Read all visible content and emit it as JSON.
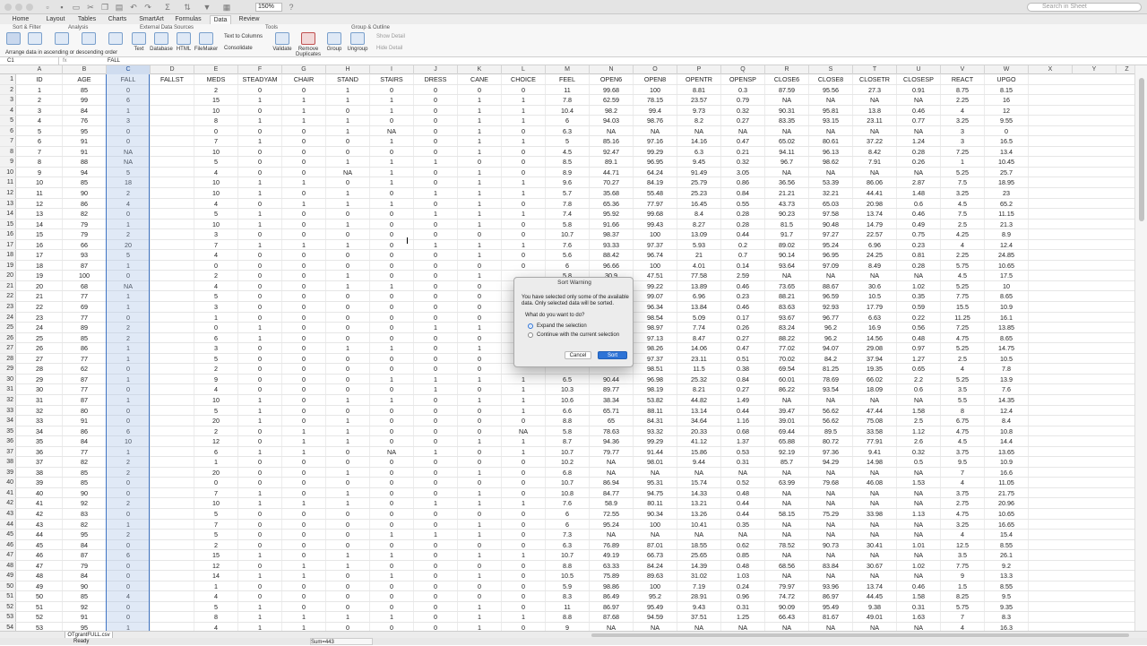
{
  "toolbar": {
    "zoom": "150%",
    "search_placeholder": "Search in Sheet"
  },
  "ribbon_tabs": [
    "Home",
    "Layout",
    "Tables",
    "Charts",
    "SmartArt",
    "Formulas",
    "Data",
    "Review"
  ],
  "active_tab": "Data",
  "ribbon": {
    "groups": [
      "Sort & Filter",
      "Analysis",
      "External Data Sources",
      "Tools",
      "Group & Outline"
    ],
    "buttons": [
      "Text",
      "Database",
      "HTML",
      "FileMaker",
      "Validate",
      "Remove Duplicates",
      "Group",
      "Ungroup"
    ],
    "tools": [
      "Text to Columns",
      "Consolidate"
    ],
    "outline": [
      "Show Detail",
      "Hide Detail"
    ],
    "tooltip": "Arrange data in ascending or descending order"
  },
  "formula_bar": {
    "name_box": "C1",
    "fx": "fx",
    "value": "FALL"
  },
  "columns": [
    "A",
    "B",
    "C",
    "D",
    "E",
    "F",
    "G",
    "H",
    "I",
    "J",
    "K",
    "L",
    "M",
    "N",
    "O",
    "P",
    "Q",
    "R",
    "S",
    "T",
    "U",
    "V",
    "W",
    "X",
    "Y",
    "Z"
  ],
  "selected_column": "C",
  "rows": [
    [
      "ID",
      "AGE",
      "FALL",
      "FALLST",
      "MEDS",
      "STEADYAM",
      "CHAIR",
      "STAND",
      "STAIRS",
      "DRESS",
      "CANE",
      "CHOICE",
      "FEEL",
      "OPEN6",
      "OPEN8",
      "OPENTR",
      "OPENSP",
      "CLOSE6",
      "CLOSE8",
      "CLOSETR",
      "CLOSESP",
      "REACT",
      "UPGO"
    ],
    [
      "1",
      "85",
      "0",
      "",
      "2",
      "0",
      "0",
      "1",
      "0",
      "0",
      "0",
      "0",
      "11",
      "99.68",
      "100",
      "8.81",
      "0.3",
      "87.59",
      "95.56",
      "27.3",
      "0.91",
      "8.75",
      "8.15"
    ],
    [
      "2",
      "99",
      "6",
      "",
      "15",
      "1",
      "1",
      "1",
      "1",
      "0",
      "1",
      "1",
      "7.8",
      "62.59",
      "78.15",
      "23.57",
      "0.79",
      "NA",
      "NA",
      "NA",
      "NA",
      "2.25",
      "16"
    ],
    [
      "3",
      "84",
      "1",
      "",
      "10",
      "0",
      "1",
      "0",
      "1",
      "0",
      "1",
      "1",
      "10.4",
      "98.2",
      "99.4",
      "9.73",
      "0.32",
      "90.31",
      "95.81",
      "13.8",
      "0.46",
      "4",
      "12"
    ],
    [
      "4",
      "76",
      "3",
      "",
      "8",
      "1",
      "1",
      "1",
      "0",
      "0",
      "1",
      "1",
      "6",
      "94.03",
      "98.76",
      "8.2",
      "0.27",
      "83.35",
      "93.15",
      "23.11",
      "0.77",
      "3.25",
      "9.55"
    ],
    [
      "5",
      "95",
      "0",
      "",
      "0",
      "0",
      "0",
      "1",
      "NA",
      "0",
      "1",
      "0",
      "6.3",
      "NA",
      "NA",
      "NA",
      "NA",
      "NA",
      "NA",
      "NA",
      "NA",
      "3",
      "0"
    ],
    [
      "6",
      "91",
      "0",
      "",
      "7",
      "1",
      "0",
      "0",
      "1",
      "0",
      "1",
      "1",
      "5",
      "85.16",
      "97.16",
      "14.16",
      "0.47",
      "65.02",
      "80.61",
      "37.22",
      "1.24",
      "3",
      "16.5"
    ],
    [
      "7",
      "91",
      "NA",
      "",
      "10",
      "0",
      "0",
      "0",
      "0",
      "0",
      "1",
      "0",
      "4.5",
      "92.47",
      "99.29",
      "6.3",
      "0.21",
      "94.11",
      "96.13",
      "8.42",
      "0.28",
      "7.25",
      "13.4"
    ],
    [
      "8",
      "88",
      "NA",
      "",
      "5",
      "0",
      "0",
      "1",
      "1",
      "1",
      "0",
      "0",
      "8.5",
      "89.1",
      "96.95",
      "9.45",
      "0.32",
      "96.7",
      "98.62",
      "7.91",
      "0.26",
      "1",
      "10.45"
    ],
    [
      "9",
      "94",
      "5",
      "",
      "4",
      "0",
      "0",
      "NA",
      "1",
      "0",
      "1",
      "0",
      "8.9",
      "44.71",
      "64.24",
      "91.49",
      "3.05",
      "NA",
      "NA",
      "NA",
      "NA",
      "5.25",
      "25.7"
    ],
    [
      "10",
      "85",
      "18",
      "",
      "10",
      "1",
      "1",
      "0",
      "1",
      "0",
      "1",
      "1",
      "9.6",
      "70.27",
      "84.19",
      "25.79",
      "0.86",
      "36.56",
      "53.39",
      "86.06",
      "2.87",
      "7.5",
      "18.95"
    ],
    [
      "11",
      "90",
      "2",
      "",
      "10",
      "1",
      "0",
      "1",
      "0",
      "1",
      "1",
      "1",
      "5.7",
      "35.68",
      "55.48",
      "25.23",
      "0.84",
      "21.21",
      "32.21",
      "44.41",
      "1.48",
      "3.25",
      "23"
    ],
    [
      "12",
      "86",
      "4",
      "",
      "4",
      "0",
      "1",
      "1",
      "1",
      "0",
      "1",
      "0",
      "7.8",
      "65.36",
      "77.97",
      "16.45",
      "0.55",
      "43.73",
      "65.03",
      "20.98",
      "0.6",
      "4.5",
      "65.2"
    ],
    [
      "13",
      "82",
      "0",
      "",
      "5",
      "1",
      "0",
      "0",
      "0",
      "1",
      "1",
      "1",
      "7.4",
      "95.92",
      "99.68",
      "8.4",
      "0.28",
      "90.23",
      "97.58",
      "13.74",
      "0.46",
      "7.5",
      "11.15"
    ],
    [
      "14",
      "79",
      "1",
      "",
      "10",
      "1",
      "0",
      "1",
      "0",
      "0",
      "1",
      "0",
      "5.8",
      "91.66",
      "99.43",
      "8.27",
      "0.28",
      "81.5",
      "90.48",
      "14.79",
      "0.49",
      "2.5",
      "21.3"
    ],
    [
      "15",
      "79",
      "2",
      "",
      "3",
      "0",
      "0",
      "0",
      "0",
      "0",
      "0",
      "0",
      "10.7",
      "98.37",
      "100",
      "13.09",
      "0.44",
      "91.7",
      "97.27",
      "22.57",
      "0.75",
      "4.25",
      "8.9"
    ],
    [
      "16",
      "66",
      "20",
      "",
      "7",
      "1",
      "1",
      "1",
      "0",
      "1",
      "1",
      "1",
      "7.6",
      "93.33",
      "97.37",
      "5.93",
      "0.2",
      "89.02",
      "95.24",
      "6.96",
      "0.23",
      "4",
      "12.4"
    ],
    [
      "17",
      "93",
      "5",
      "",
      "4",
      "0",
      "0",
      "0",
      "0",
      "0",
      "1",
      "0",
      "5.6",
      "88.42",
      "96.74",
      "21",
      "0.7",
      "90.14",
      "96.95",
      "24.25",
      "0.81",
      "2.25",
      "24.85"
    ],
    [
      "18",
      "87",
      "1",
      "",
      "0",
      "0",
      "0",
      "0",
      "0",
      "0",
      "0",
      "0",
      "6",
      "96.66",
      "100",
      "4.01",
      "0.14",
      "93.64",
      "97.09",
      "8.49",
      "0.28",
      "5.75",
      "10.65"
    ],
    [
      "19",
      "100",
      "0",
      "",
      "2",
      "0",
      "0",
      "1",
      "0",
      "0",
      "1",
      "",
      "5.8",
      "30.9",
      "47.51",
      "77.58",
      "2.59",
      "NA",
      "NA",
      "NA",
      "NA",
      "4.5",
      "17.5"
    ],
    [
      "20",
      "68",
      "NA",
      "",
      "4",
      "0",
      "0",
      "1",
      "1",
      "0",
      "0",
      "",
      "",
      "",
      "99.22",
      "13.89",
      "0.46",
      "73.65",
      "88.67",
      "30.6",
      "1.02",
      "5.25",
      "10"
    ],
    [
      "21",
      "77",
      "1",
      "",
      "5",
      "0",
      "0",
      "0",
      "0",
      "0",
      "0",
      "",
      "",
      "",
      "99.07",
      "6.96",
      "0.23",
      "88.21",
      "96.59",
      "10.5",
      "0.35",
      "7.75",
      "8.65"
    ],
    [
      "22",
      "69",
      "1",
      "",
      "3",
      "0",
      "0",
      "0",
      "0",
      "0",
      "0",
      "",
      "",
      "",
      "96.34",
      "13.84",
      "0.46",
      "83.63",
      "92.93",
      "17.79",
      "0.59",
      "15.5",
      "10.9"
    ],
    [
      "23",
      "77",
      "0",
      "",
      "1",
      "0",
      "0",
      "0",
      "0",
      "0",
      "0",
      "",
      "",
      "",
      "98.54",
      "5.09",
      "0.17",
      "93.67",
      "96.77",
      "6.63",
      "0.22",
      "11.25",
      "16.1"
    ],
    [
      "24",
      "89",
      "2",
      "",
      "0",
      "1",
      "0",
      "0",
      "0",
      "1",
      "1",
      "",
      "",
      "",
      "98.97",
      "7.74",
      "0.26",
      "83.24",
      "96.2",
      "16.9",
      "0.56",
      "7.25",
      "13.85"
    ],
    [
      "25",
      "85",
      "2",
      "",
      "6",
      "1",
      "0",
      "0",
      "0",
      "0",
      "0",
      "",
      "",
      "",
      "97.13",
      "8.47",
      "0.27",
      "88.22",
      "96.2",
      "14.56",
      "0.48",
      "4.75",
      "8.65"
    ],
    [
      "26",
      "86",
      "1",
      "",
      "3",
      "0",
      "0",
      "1",
      "1",
      "0",
      "1",
      "",
      "",
      "",
      "98.26",
      "14.06",
      "0.47",
      "77.02",
      "94.07",
      "29.08",
      "0.97",
      "5.25",
      "14.75"
    ],
    [
      "27",
      "77",
      "1",
      "",
      "5",
      "0",
      "0",
      "0",
      "0",
      "0",
      "0",
      "",
      "",
      "",
      "97.37",
      "23.11",
      "0.51",
      "70.02",
      "84.2",
      "37.94",
      "1.27",
      "2.5",
      "10.5"
    ],
    [
      "28",
      "62",
      "0",
      "",
      "2",
      "0",
      "0",
      "0",
      "0",
      "0",
      "0",
      "",
      "",
      "",
      "98.51",
      "11.5",
      "0.38",
      "69.54",
      "81.25",
      "19.35",
      "0.65",
      "4",
      "7.8"
    ],
    [
      "29",
      "87",
      "1",
      "",
      "9",
      "0",
      "0",
      "0",
      "1",
      "1",
      "1",
      "1",
      "6.5",
      "90.44",
      "96.98",
      "25.32",
      "0.84",
      "60.01",
      "78.69",
      "66.02",
      "2.2",
      "5.25",
      "13.9"
    ],
    [
      "30",
      "77",
      "0",
      "",
      "4",
      "0",
      "0",
      "0",
      "0",
      "1",
      "0",
      "1",
      "10.3",
      "89.77",
      "98.19",
      "8.21",
      "0.27",
      "86.22",
      "93.54",
      "18.09",
      "0.6",
      "3.5",
      "7.6"
    ],
    [
      "31",
      "87",
      "1",
      "",
      "10",
      "1",
      "0",
      "1",
      "1",
      "0",
      "1",
      "1",
      "10.6",
      "38.34",
      "53.82",
      "44.82",
      "1.49",
      "NA",
      "NA",
      "NA",
      "NA",
      "5.5",
      "14.35"
    ],
    [
      "32",
      "80",
      "0",
      "",
      "5",
      "1",
      "0",
      "0",
      "0",
      "0",
      "0",
      "1",
      "6.6",
      "65.71",
      "88.11",
      "13.14",
      "0.44",
      "39.47",
      "56.62",
      "47.44",
      "1.58",
      "8",
      "12.4"
    ],
    [
      "33",
      "91",
      "0",
      "",
      "20",
      "1",
      "0",
      "1",
      "0",
      "0",
      "0",
      "0",
      "8.8",
      "65",
      "84.31",
      "34.64",
      "1.16",
      "39.01",
      "56.62",
      "75.08",
      "2.5",
      "6.75",
      "8.4"
    ],
    [
      "34",
      "86",
      "6",
      "",
      "2",
      "0",
      "1",
      "1",
      "0",
      "0",
      "0",
      "NA",
      "5.8",
      "78.63",
      "93.32",
      "20.33",
      "0.68",
      "69.44",
      "89.5",
      "33.58",
      "1.12",
      "4.75",
      "10.8"
    ],
    [
      "35",
      "84",
      "10",
      "",
      "12",
      "0",
      "1",
      "1",
      "0",
      "0",
      "1",
      "1",
      "8.7",
      "94.36",
      "99.29",
      "41.12",
      "1.37",
      "65.88",
      "80.72",
      "77.91",
      "2.6",
      "4.5",
      "14.4"
    ],
    [
      "36",
      "77",
      "1",
      "",
      "6",
      "1",
      "1",
      "0",
      "NA",
      "1",
      "0",
      "1",
      "10.7",
      "79.77",
      "91.44",
      "15.86",
      "0.53",
      "92.19",
      "97.36",
      "9.41",
      "0.32",
      "3.75",
      "13.65"
    ],
    [
      "37",
      "82",
      "2",
      "",
      "1",
      "0",
      "0",
      "0",
      "0",
      "0",
      "0",
      "0",
      "10.2",
      "NA",
      "98.01",
      "9.44",
      "0.31",
      "85.7",
      "94.29",
      "14.98",
      "0.5",
      "9.5",
      "10.9"
    ],
    [
      "38",
      "85",
      "2",
      "",
      "20",
      "0",
      "0",
      "1",
      "0",
      "0",
      "1",
      "0",
      "6.8",
      "NA",
      "NA",
      "NA",
      "NA",
      "NA",
      "NA",
      "NA",
      "NA",
      "7",
      "16.6"
    ],
    [
      "39",
      "85",
      "0",
      "",
      "0",
      "0",
      "0",
      "0",
      "0",
      "0",
      "0",
      "0",
      "10.7",
      "86.94",
      "95.31",
      "15.74",
      "0.52",
      "63.99",
      "79.68",
      "46.08",
      "1.53",
      "4",
      "11.05"
    ],
    [
      "40",
      "90",
      "0",
      "",
      "7",
      "1",
      "0",
      "1",
      "0",
      "0",
      "1",
      "0",
      "10.8",
      "84.77",
      "94.75",
      "14.33",
      "0.48",
      "NA",
      "NA",
      "NA",
      "NA",
      "3.75",
      "21.75"
    ],
    [
      "41",
      "92",
      "2",
      "",
      "10",
      "1",
      "1",
      "1",
      "0",
      "1",
      "1",
      "1",
      "7.6",
      "58.9",
      "80.11",
      "13.21",
      "0.44",
      "NA",
      "NA",
      "NA",
      "NA",
      "2.75",
      "20.96"
    ],
    [
      "42",
      "83",
      "0",
      "",
      "5",
      "0",
      "0",
      "0",
      "0",
      "0",
      "0",
      "0",
      "6",
      "72.55",
      "90.34",
      "13.26",
      "0.44",
      "58.15",
      "75.29",
      "33.98",
      "1.13",
      "4.75",
      "10.65"
    ],
    [
      "43",
      "82",
      "1",
      "",
      "7",
      "0",
      "0",
      "0",
      "0",
      "0",
      "1",
      "0",
      "6",
      "95.24",
      "100",
      "10.41",
      "0.35",
      "NA",
      "NA",
      "NA",
      "NA",
      "3.25",
      "16.65"
    ],
    [
      "44",
      "95",
      "2",
      "",
      "5",
      "0",
      "0",
      "0",
      "1",
      "1",
      "1",
      "0",
      "7.3",
      "NA",
      "NA",
      "NA",
      "NA",
      "NA",
      "NA",
      "NA",
      "NA",
      "4",
      "15.4"
    ],
    [
      "45",
      "84",
      "0",
      "",
      "2",
      "0",
      "0",
      "0",
      "0",
      "0",
      "0",
      "0",
      "6.3",
      "76.89",
      "87.01",
      "18.55",
      "0.62",
      "78.52",
      "90.73",
      "30.41",
      "1.01",
      "12.5",
      "8.55"
    ],
    [
      "46",
      "87",
      "6",
      "",
      "15",
      "1",
      "0",
      "1",
      "1",
      "0",
      "1",
      "1",
      "10.7",
      "49.19",
      "66.73",
      "25.65",
      "0.85",
      "NA",
      "NA",
      "NA",
      "NA",
      "3.5",
      "26.1"
    ],
    [
      "47",
      "79",
      "0",
      "",
      "12",
      "0",
      "1",
      "1",
      "0",
      "0",
      "0",
      "0",
      "8.8",
      "63.33",
      "84.24",
      "14.39",
      "0.48",
      "68.56",
      "83.84",
      "30.67",
      "1.02",
      "7.75",
      "9.2"
    ],
    [
      "48",
      "84",
      "0",
      "",
      "14",
      "1",
      "1",
      "0",
      "1",
      "0",
      "1",
      "0",
      "10.5",
      "75.89",
      "89.63",
      "31.02",
      "1.03",
      "NA",
      "NA",
      "NA",
      "NA",
      "9",
      "13.3"
    ],
    [
      "49",
      "90",
      "0",
      "",
      "1",
      "0",
      "0",
      "0",
      "0",
      "0",
      "0",
      "0",
      "5.9",
      "98.86",
      "100",
      "7.19",
      "0.24",
      "79.97",
      "93.96",
      "13.74",
      "0.46",
      "1.5",
      "8.55"
    ],
    [
      "50",
      "85",
      "4",
      "",
      "4",
      "0",
      "0",
      "0",
      "0",
      "0",
      "0",
      "0",
      "8.3",
      "86.49",
      "95.2",
      "28.91",
      "0.96",
      "74.72",
      "86.97",
      "44.45",
      "1.58",
      "8.25",
      "9.5"
    ],
    [
      "51",
      "92",
      "0",
      "",
      "5",
      "1",
      "0",
      "0",
      "0",
      "0",
      "1",
      "0",
      "11",
      "86.97",
      "95.49",
      "9.43",
      "0.31",
      "90.09",
      "95.49",
      "9.38",
      "0.31",
      "5.75",
      "9.35"
    ],
    [
      "52",
      "91",
      "0",
      "",
      "8",
      "1",
      "1",
      "1",
      "1",
      "0",
      "1",
      "1",
      "8.8",
      "87.68",
      "94.59",
      "37.51",
      "1.25",
      "66.43",
      "81.67",
      "49.01",
      "1.63",
      "7",
      "8.3"
    ],
    [
      "53",
      "95",
      "1",
      "",
      "4",
      "1",
      "1",
      "0",
      "0",
      "0",
      "1",
      "0",
      "9",
      "NA",
      "NA",
      "NA",
      "NA",
      "NA",
      "NA",
      "NA",
      "NA",
      "4",
      "16.3"
    ]
  ],
  "sheet_tab": "OTgrantFULL.csv",
  "status": {
    "ready": "Ready",
    "sum": "Sum=443"
  },
  "dialog": {
    "title": "Sort Warning",
    "message": "You have selected only some of the available data. Only selected data will be sorted.",
    "question": "What do you want to do?",
    "option1": "Expand the selection",
    "option2": "Continue with the current selection",
    "cancel": "Cancel",
    "sort": "Sort"
  }
}
